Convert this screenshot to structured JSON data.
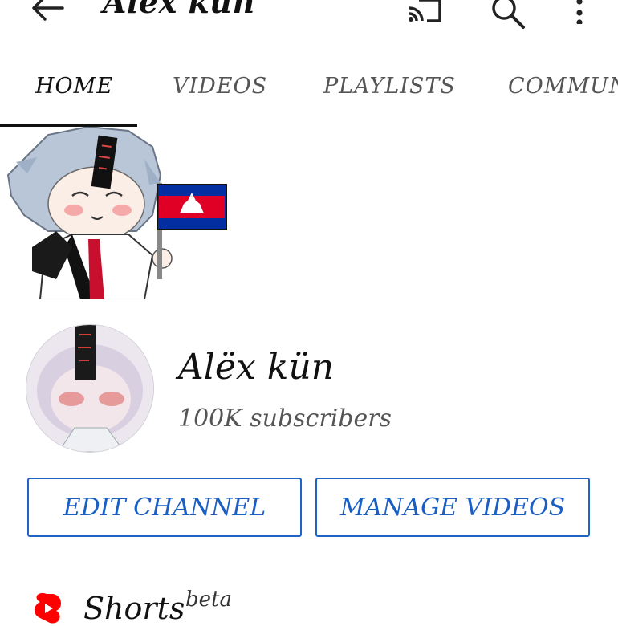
{
  "header": {
    "title": "Alex kün",
    "icons": [
      "back-arrow-icon",
      "cast-icon",
      "search-icon",
      "more-vert-icon"
    ]
  },
  "tabs": [
    {
      "label": "HOME",
      "active": true
    },
    {
      "label": "VIDEOS",
      "active": false
    },
    {
      "label": "PLAYLISTS",
      "active": false
    },
    {
      "label": "COMMUNITY",
      "active": false
    }
  ],
  "channel": {
    "name": "Alëx kün",
    "subscribers": "100K subscribers"
  },
  "actions": {
    "edit_label": "EDIT CHANNEL",
    "manage_label": "MANAGE VIDEOS"
  },
  "shorts": {
    "label": "Shorts",
    "badge": "beta"
  },
  "colors": {
    "accent": "#1f63c5",
    "shorts_red": "#ff0000",
    "text_primary": "#111111",
    "text_secondary": "#555555"
  }
}
